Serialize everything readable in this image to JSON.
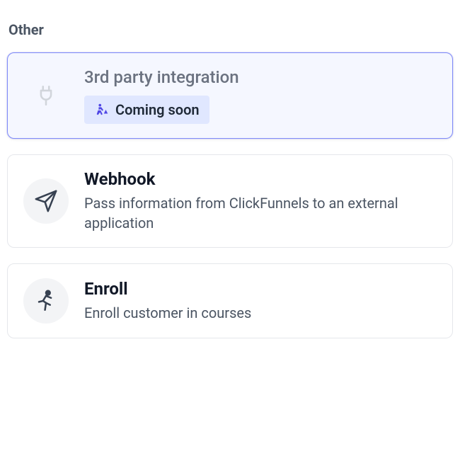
{
  "section": {
    "title": "Other"
  },
  "cards": {
    "integration": {
      "title": "3rd party integration",
      "badge": "Coming soon"
    },
    "webhook": {
      "title": "Webhook",
      "desc": "Pass information from ClickFunnels to an external application"
    },
    "enroll": {
      "title": "Enroll",
      "desc": "Enroll customer in courses"
    }
  }
}
